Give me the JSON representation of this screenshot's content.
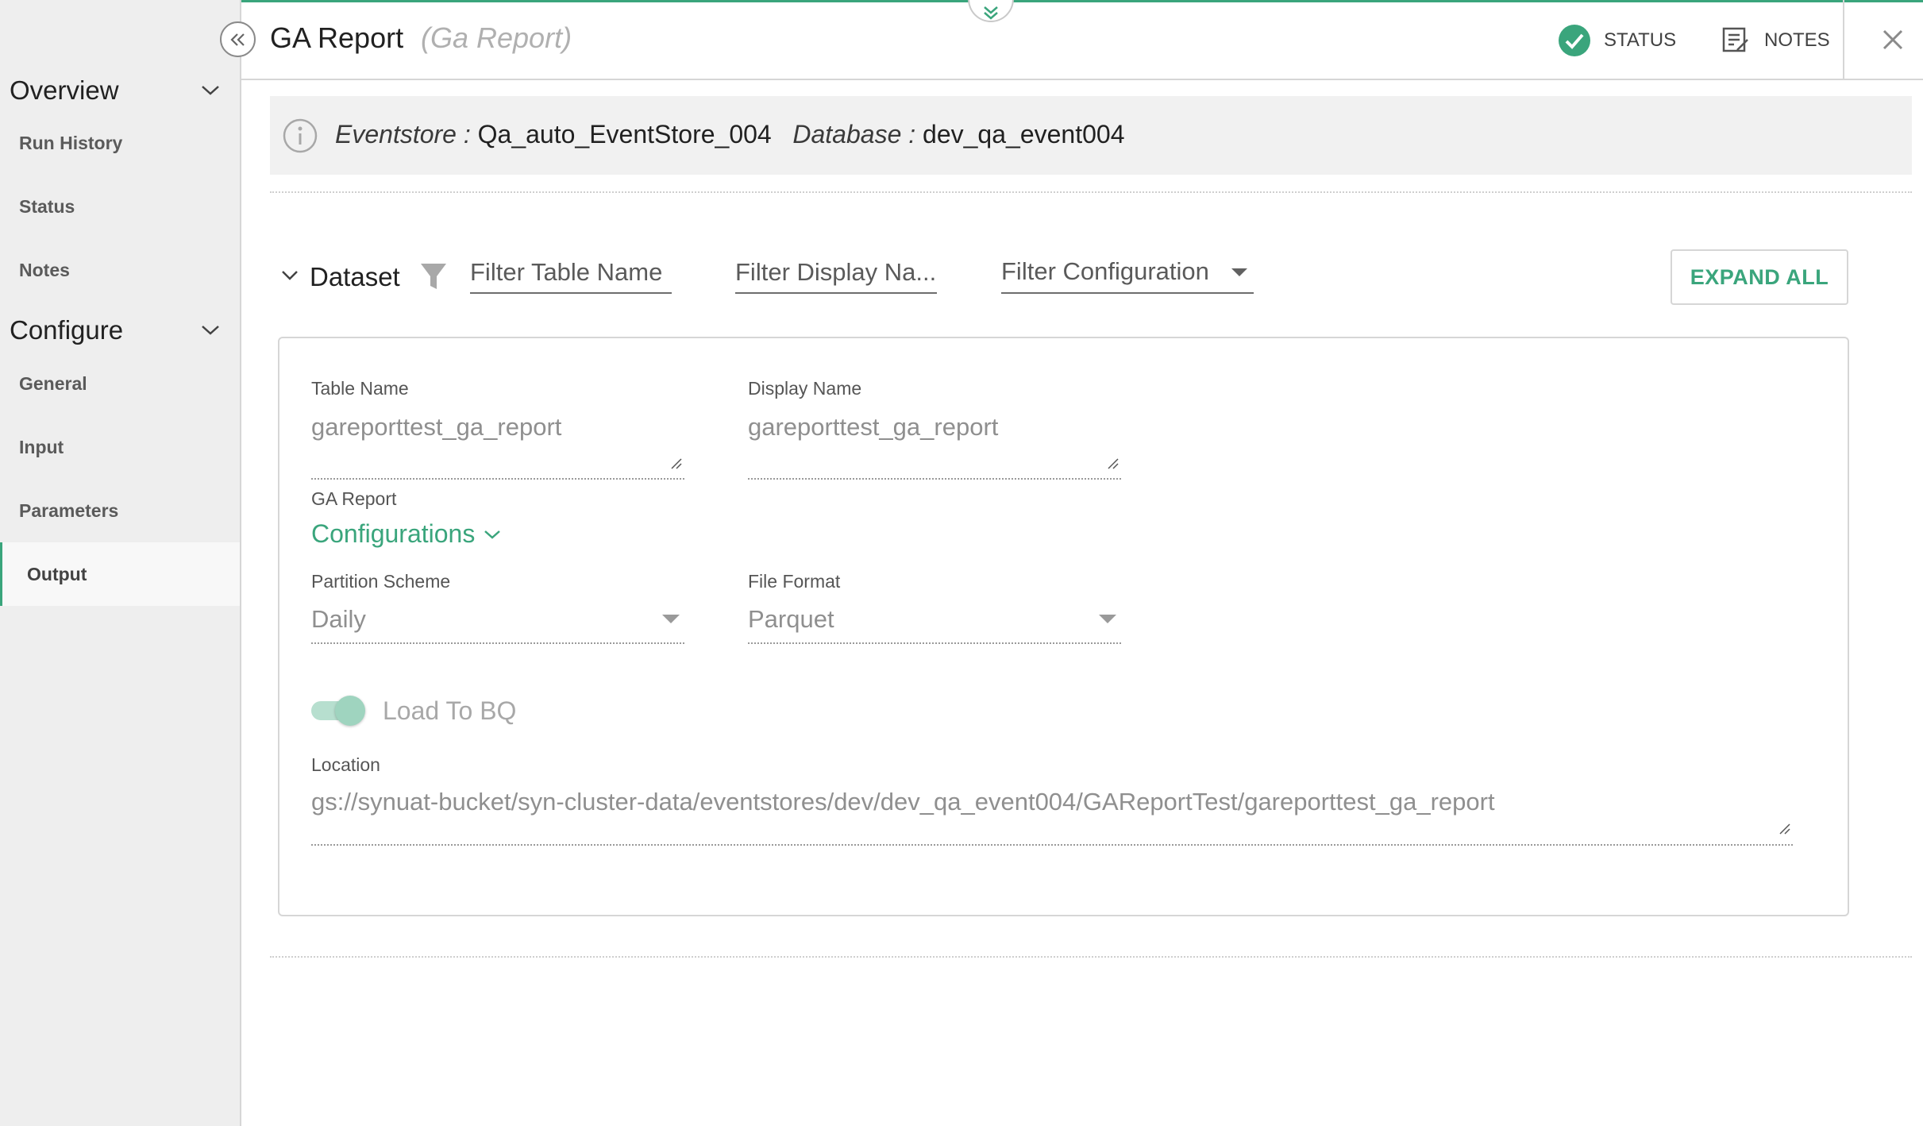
{
  "header": {
    "title": "GA Report",
    "subtitle": "(Ga Report)",
    "status_label": "STATUS",
    "notes_label": "NOTES"
  },
  "sidebar": {
    "sections": [
      {
        "title": "Overview",
        "items": [
          "Run History",
          "Status",
          "Notes"
        ]
      },
      {
        "title": "Configure",
        "items": [
          "General",
          "Input",
          "Parameters",
          "Output"
        ]
      }
    ],
    "active_item": "Output"
  },
  "info": {
    "eventstore_label": "Eventstore :",
    "eventstore_value": "Qa_auto_EventStore_004",
    "database_label": "Database :",
    "database_value": "dev_qa_event004"
  },
  "dataset": {
    "label": "Dataset",
    "filter_table_placeholder": "Filter Table Name",
    "filter_display_placeholder": "Filter Display Na...",
    "filter_configuration_label": "Filter Configuration",
    "expand_all_label": "EXPAND ALL"
  },
  "card": {
    "table_name_label": "Table Name",
    "table_name_value": "gareporttest_ga_report",
    "display_name_label": "Display Name",
    "display_name_value": "gareporttest_ga_report",
    "ga_report_label": "GA Report",
    "configurations_link": "Configurations",
    "partition_label": "Partition Scheme",
    "partition_value": "Daily",
    "file_format_label": "File Format",
    "file_format_value": "Parquet",
    "load_to_bq_label": "Load To BQ",
    "load_to_bq_enabled": true,
    "location_label": "Location",
    "location_value": "gs://synuat-bucket/syn-cluster-data/eventstores/dev/dev_qa_event004/GAReportTest/gareporttest_ga_report"
  },
  "colors": {
    "accent": "#3aa57c",
    "sidebar_bg": "#eeeeee",
    "banner_bg": "#f1f1f1"
  }
}
